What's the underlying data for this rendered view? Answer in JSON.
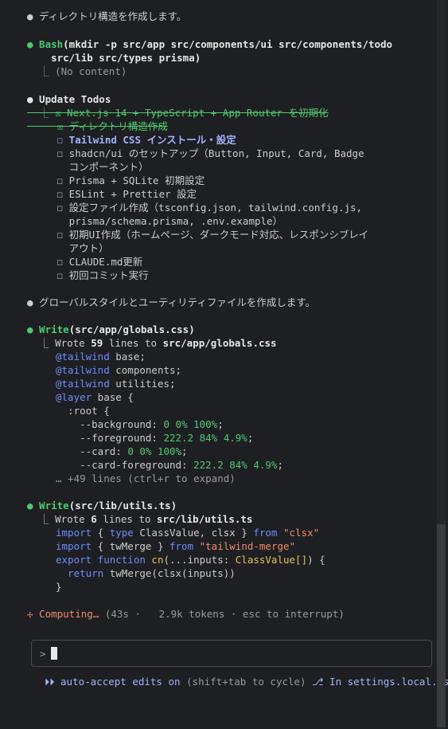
{
  "m1": "● ディレクトリ構造を作成します。",
  "bash_head": "● Bash",
  "bash_cmd1": "(mkdir -p src/app src/components/ui src/components/todo",
  "bash_cmd2": "    src/lib src/types prisma)",
  "bash_out": "  ⎿ (No content)",
  "todos_title": "● Update Todos",
  "t1": "  ⎿ ☒ Next.js 14 + TypeScript + App Router を初期化",
  "t2": "     ☒ ディレクトリ構造作成",
  "t3": "     ☐ Tailwind CSS インストール・設定",
  "t4": "     ☐ shadcn/ui のセットアップ（Button, Input, Card, Badge",
  "t4b": "       コンポーネント）",
  "t5": "     ☐ Prisma + SQLite 初期設定",
  "t6": "     ☐ ESLint + Prettier 設定",
  "t7": "     ☐ 設定ファイル作成（tsconfig.json, tailwind.config.js,",
  "t7b": "       prisma/schema.prisma, .env.example）",
  "t8": "     ☐ 初期UI作成（ホームページ、ダークモード対応、レスポンシブレイ",
  "t8b": "       アウト）",
  "t9": "     ☐ CLAUDE.md更新",
  "t10": "     ☐ 初回コミット実行",
  "m2": "● グローバルスタイルとユーティリティファイルを作成します。",
  "w1_head": "● Write",
  "w1_path": "(src/app/globals.css)",
  "w1_res_a": "  ⎿ Wrote ",
  "w1_res_n": "59",
  "w1_res_b": " lines to ",
  "w1_res_p": "src/app/globals.css",
  "c1": "@tailwind",
  "c1b": " base;",
  "c2b": " components;",
  "c3b": " utilities;",
  "c4": "@layer",
  "c4b": " base {",
  "c5": "  :root {",
  "c6a": "    --background: ",
  "c6b": "0 0% 100%",
  "c7a": "    --foreground: ",
  "c7b": "222.2 84% 4.9%",
  "c8a": "    --card: ",
  "c8b": "0 0% 100%",
  "c9a": "    --card-foreground: ",
  "c9b": "222.2 84% 4.9%",
  "semi": ";",
  "more": "… +49 lines (ctrl+r to expand)",
  "w2_head": "● Write",
  "w2_path": "(src/lib/utils.ts)",
  "w2_res_n": "6",
  "w2_res_p": "src/lib/utils.ts",
  "u1_import": "import",
  "u1_mid": " { ",
  "u1_type": "type",
  "u1_rest": " ClassValue, clsx } ",
  "u1_from": "from",
  "u1_str": " \"clsx\"",
  "u2_rest": " { twMerge } ",
  "u2_str": " \"tailwind-merge\"",
  "u3_export": "export",
  "u3_function": " function",
  "u3_cn": " cn",
  "u3_rest": "(...inputs: ",
  "u3_cv": "ClassValue[]",
  "u3_end": ") {",
  "u4_return": "  return",
  "u4_rest": " twMerge(clsx(inputs))",
  "u5": "}",
  "status": "✢ Computing… ",
  "status_dim": "(43s ·   2.9k tokens · esc to interrupt)",
  "prompt": ">",
  "footer_a": "⏵⏵ auto-accept edits on",
  "footer_dim": " (shift+tab to cycle)",
  "footer_b": " ⎇ In settings.local.json"
}
